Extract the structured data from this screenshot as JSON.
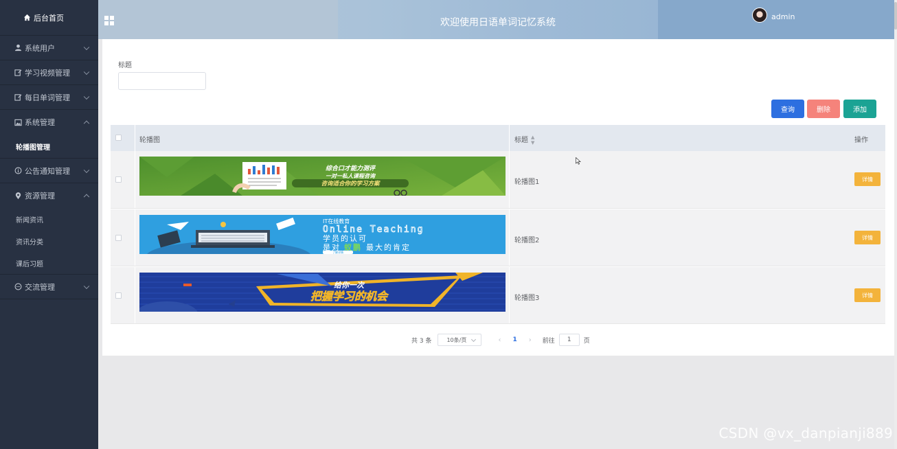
{
  "sidebar": {
    "home": {
      "label": "后台首页",
      "icon": "home-icon"
    },
    "items": [
      {
        "label": "系统用户",
        "icon": "user-icon",
        "expanded": false
      },
      {
        "label": "学习视频管理",
        "icon": "edit-icon",
        "expanded": false
      },
      {
        "label": "每日单词管理",
        "icon": "edit-icon",
        "expanded": false
      },
      {
        "label": "系统管理",
        "icon": "picture-icon",
        "expanded": true,
        "children": [
          "轮播图管理"
        ]
      },
      {
        "label": "公告通知管理",
        "icon": "info-icon",
        "expanded": false
      },
      {
        "label": "资源管理",
        "icon": "location-icon",
        "expanded": true,
        "children": [
          "新闻资讯",
          "资讯分类",
          "课后习题"
        ]
      },
      {
        "label": "交流管理",
        "icon": "chat-icon",
        "expanded": false
      }
    ]
  },
  "header": {
    "title": "欢迎使用日语单词记忆系统",
    "username": "admin"
  },
  "search": {
    "label": "标题",
    "value": "",
    "placeholder": ""
  },
  "buttons": {
    "query": "查询",
    "delete": "删除",
    "add": "添加"
  },
  "table": {
    "columns": [
      "轮播图",
      "标题",
      "操作"
    ],
    "rows": [
      {
        "title": "轮播图1",
        "action": "详情",
        "banner_text": [
          "综合口才能力测评",
          "一对一私人课程咨询",
          "咨询适合你的学习方案"
        ]
      },
      {
        "title": "轮播图2",
        "action": "详情",
        "banner_text": [
          "IT在线教育",
          "Online Teaching",
          "学员的认可",
          "是对",
          "蚁鹏",
          "最大的肯定",
          "了解详情"
        ]
      },
      {
        "title": "轮播图3",
        "action": "详情",
        "banner_text": [
          "给你一次",
          "把握学习的机会"
        ]
      }
    ]
  },
  "pagination": {
    "total_text": "共 3 条",
    "page_size": "10条/页",
    "current_page": "1",
    "goto_label": "前往",
    "goto_value": "1",
    "page_suffix": "页"
  },
  "watermark": "CSDN @vx_danpianji889",
  "colors": {
    "sidebar_bg": "#283142",
    "query_btn": "#2d6fe0",
    "delete_btn": "#f5837b",
    "add_btn": "#1ba394",
    "detail_btn": "#f3b33b"
  }
}
